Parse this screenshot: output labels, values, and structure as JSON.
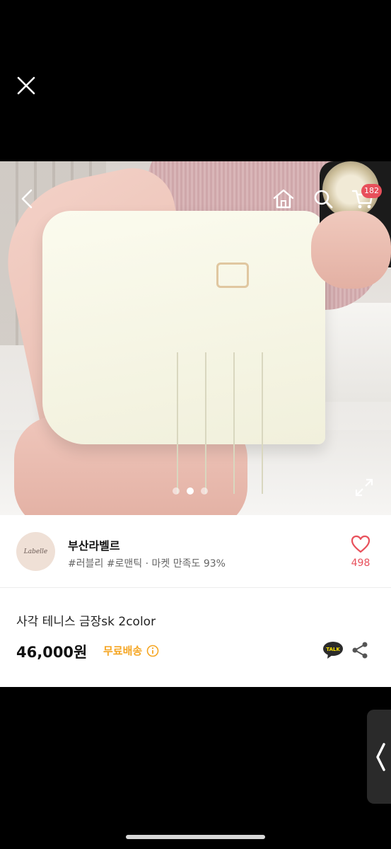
{
  "overlay": {
    "close_icon": "close-icon"
  },
  "header": {
    "icons": [
      "back-icon",
      "home-icon",
      "search-icon",
      "cart-icon"
    ],
    "cart_count": "182"
  },
  "image_carousel": {
    "dots": 3,
    "active_index": 1,
    "expand_icon": "expand-icon"
  },
  "seller": {
    "avatar_text": "Labelle",
    "name": "부산라벨르",
    "tags": "#러블리 #로맨틱 · 마켓 만족도 93%",
    "likes": "498",
    "like_icon": "heart-icon"
  },
  "product": {
    "title": "사각 테니스 금장sk 2color",
    "price": "46,000원",
    "shipping": "무료배송",
    "info_icon": "info-icon",
    "talk_label": "TALK",
    "share_icon": "share-icon"
  },
  "colors": {
    "accent": "#e8505b",
    "shipping": "#f5a623",
    "background": "#000000"
  },
  "side_tab": {
    "icon": "chevron-left-icon"
  }
}
